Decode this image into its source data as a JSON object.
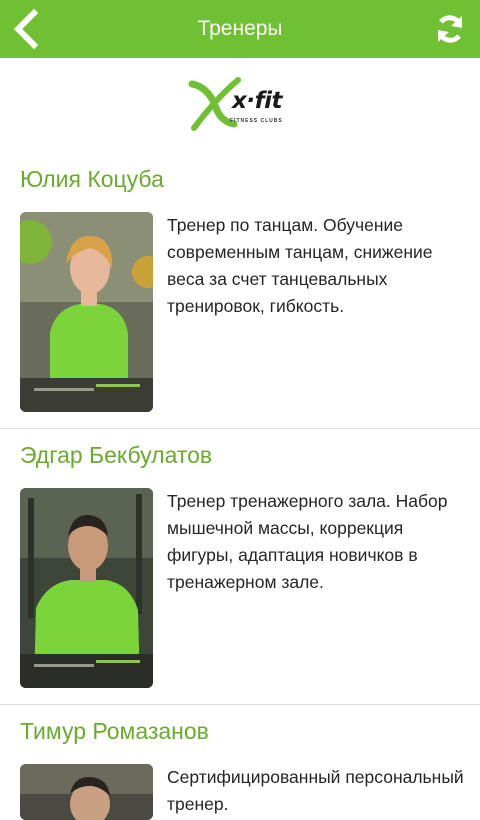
{
  "header": {
    "title": "Тренеры",
    "back_icon": "chevron-left-icon",
    "refresh_icon": "refresh-icon",
    "accent_color": "#6fc033"
  },
  "logo": {
    "wordmark": "x·fit",
    "tagline": "FITNESS CLUBS"
  },
  "trainers": [
    {
      "name": "Юлия Коцуба",
      "description": "Тренер по танцам. Обучение современным танцам, снижение веса за счет танцевальных тренировок, гибкость."
    },
    {
      "name": "Эдгар Бекбулатов",
      "description": "Тренер тренажерного зала. Набор мышечной массы, коррекция фигуры, адаптация новичков в тренажерном зале."
    },
    {
      "name": "Тимур Ромазанов",
      "description": "Сертифицированный персональный тренер."
    }
  ],
  "name_color": "#6aaa2e"
}
